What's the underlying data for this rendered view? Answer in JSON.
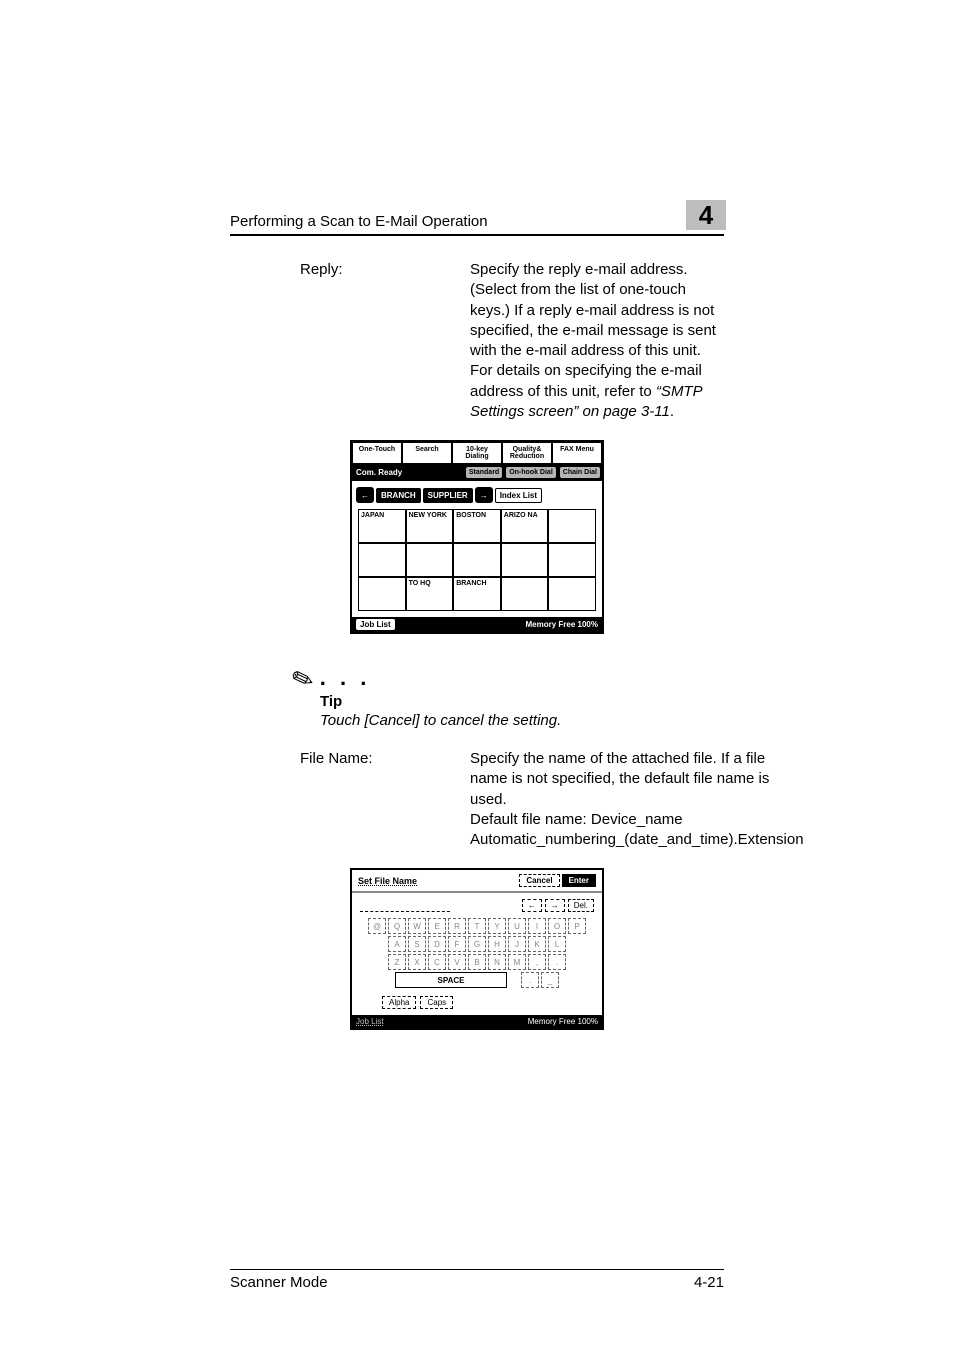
{
  "header": {
    "section_title": "Performing a Scan to E-Mail Operation",
    "chapter_number": "4"
  },
  "reply": {
    "label": "Reply:",
    "text_main": "Specify the reply e-mail address. (Select from the list of one-touch keys.) If a reply e-mail address is not specified, the e-mail message is sent with the e-mail address of this unit. For details on specifying the e-mail address of this unit, refer to ",
    "text_ref": "“SMTP Settings screen” on page 3-11",
    "text_end": "."
  },
  "figure1": {
    "tabs": [
      "One-Touch",
      "Search",
      "10-key Dialing",
      "Quality& Reduction",
      "FAX Menu"
    ],
    "ready": "Com. Ready",
    "mode_buttons": [
      "Standard",
      "On-hook Dial",
      "Chain Dial"
    ],
    "arrow_left": "←",
    "branch": "BRANCH",
    "supplier": "SUPPLIER",
    "arrow_right": "→",
    "index_list": "Index List",
    "cells": [
      "JAPAN",
      "NEW YORK",
      "BOSTON",
      "ARIZO NA",
      "",
      "",
      "",
      "",
      "",
      "",
      "",
      "TO HQ",
      "BRANCH",
      "",
      ""
    ],
    "job_list": "Job List",
    "memory": "Memory Free 100%"
  },
  "tip": {
    "heading": "Tip",
    "body": "Touch [Cancel] to cancel the setting."
  },
  "filename": {
    "label": "File Name:",
    "para1": "Specify the name of the attached file. If a file name is not specified, the default file name is used.",
    "para2": "Default file name: Device_name Automatic_numbering_(date_and_time).Extension"
  },
  "figure2": {
    "title": "Set File Name",
    "cancel": "Cancel",
    "enter": "Enter",
    "nav_left": "←",
    "nav_right": "→",
    "del": "Del.",
    "rows": [
      [
        "@",
        "Q",
        "W",
        "E",
        "R",
        "T",
        "Y",
        "U",
        "I",
        "O",
        "P"
      ],
      [
        "A",
        "S",
        "D",
        "F",
        "G",
        "H",
        "J",
        "K",
        "L"
      ],
      [
        "Z",
        "X",
        "C",
        "V",
        "B",
        "N",
        "M",
        ",",
        "."
      ]
    ],
    "space": "SPACE",
    "extra_keys": [
      ".",
      "_"
    ],
    "alpha": "Alpha",
    "caps": "Caps",
    "job_list": "Job List",
    "memory": "Memory Free 100%"
  },
  "footer": {
    "left": "Scanner Mode",
    "right": "4-21"
  }
}
